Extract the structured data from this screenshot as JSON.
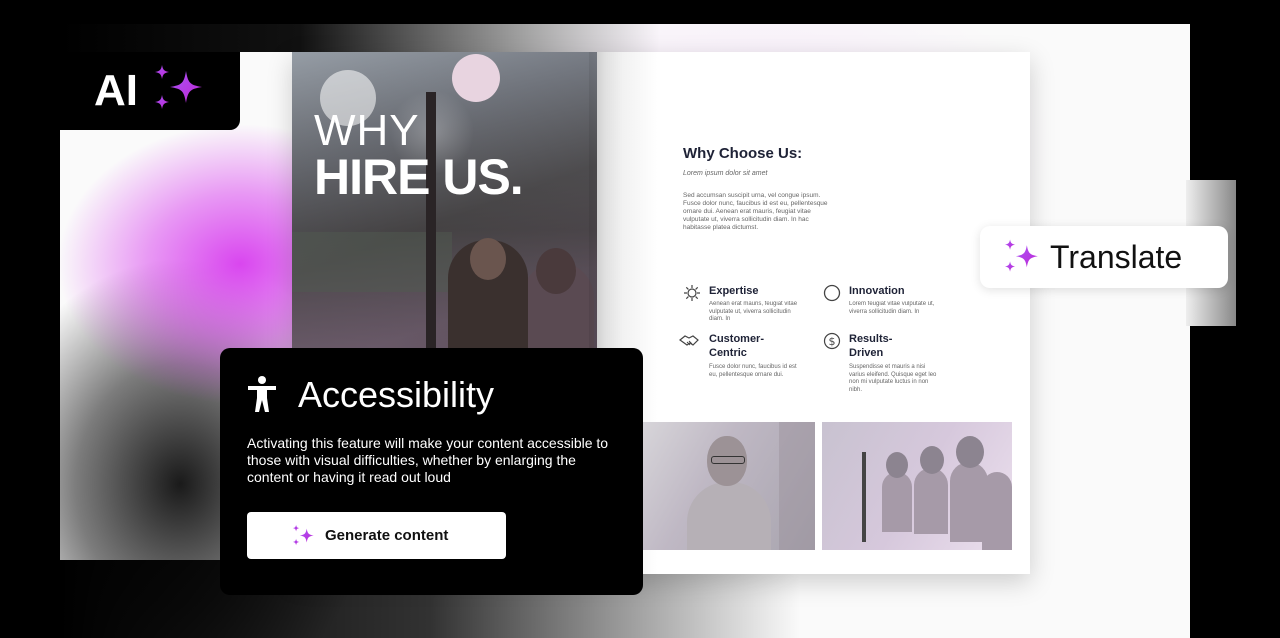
{
  "badge": {
    "text": "AI"
  },
  "brochure": {
    "cover_title_light": "WHY",
    "cover_title_bold": "HIRE US.",
    "heading": "Why Choose Us:",
    "subheading": "Lorem ipsum dolor sit amet",
    "intro": "Sed accumsan suscipit urna, vel congue ipsum. Fusce dolor nunc, faucibus id est eu, pellentesque ornare dui. Aenean erat mauris, feugiat vitae vulputate ut, viverra sollicitudin diam. In hac habitasse platea dictumst.",
    "features": [
      {
        "icon": "gear-icon",
        "title": "Expertise",
        "description": "Aenean erat mauris, feugiat vitae vulputate ut, viverra sollicitudin diam. In"
      },
      {
        "icon": "circle-icon",
        "title": "Innovation",
        "description": "Lorem feugiat vitae vulputate ut, viverra sollicitudin diam. In"
      },
      {
        "icon": "handshake-icon",
        "title": "Customer-Centric",
        "title_line1": "Customer-",
        "title_line2": "Centric",
        "description": "Fusce dolor nunc, faucibus id est eu, pellentesque ornare dui."
      },
      {
        "icon": "dollar-icon",
        "title": "Results-Driven",
        "title_line1": "Results-",
        "title_line2": "Driven",
        "description": "Suspendisse et mauris a nisi varius eleifend. Quisque eget leo non mi vulputate luctus in non nibh."
      }
    ]
  },
  "translate": {
    "label": "Translate",
    "icon": "sparkle-icon"
  },
  "accessibility": {
    "icon": "accessibility-person-icon",
    "title": "Accessibility",
    "description": "Activating this feature will make your content accessible to those with visual difficulties, whether by enlarging the content or having it read out loud",
    "button_label": "Generate content"
  },
  "colors": {
    "accent_purple": "#8b5cf6",
    "accent_magenta": "#d946ef",
    "dark": "#000000",
    "navy_text": "#1e2236"
  }
}
